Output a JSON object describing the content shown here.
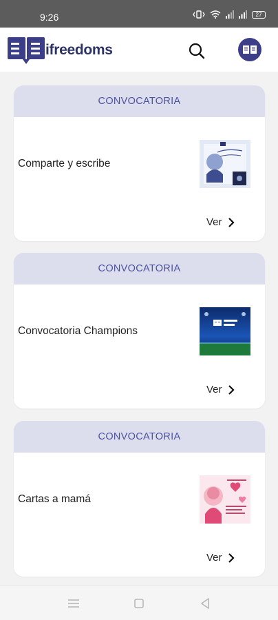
{
  "status_bar": {
    "time": "9:26",
    "battery": "27"
  },
  "header": {
    "logo_text": "ifreedoms"
  },
  "cards": [
    {
      "category": "CONVOCATORIA",
      "title": "Comparte y escribe",
      "link_label": "Ver"
    },
    {
      "category": "CONVOCATORIA",
      "title": "Convocatoria Champions",
      "link_label": "Ver"
    },
    {
      "category": "CONVOCATORIA",
      "title": "Cartas a mamá",
      "link_label": "Ver"
    }
  ],
  "icons": {
    "search": "search-icon",
    "profile": "book-icon",
    "nav_menu": "menu-icon",
    "nav_home": "square-icon",
    "nav_back": "triangle-back-icon"
  },
  "colors": {
    "brand": "#3c3f87",
    "card_header_bg": "#dcdded",
    "card_header_text": "#4c52a3"
  }
}
